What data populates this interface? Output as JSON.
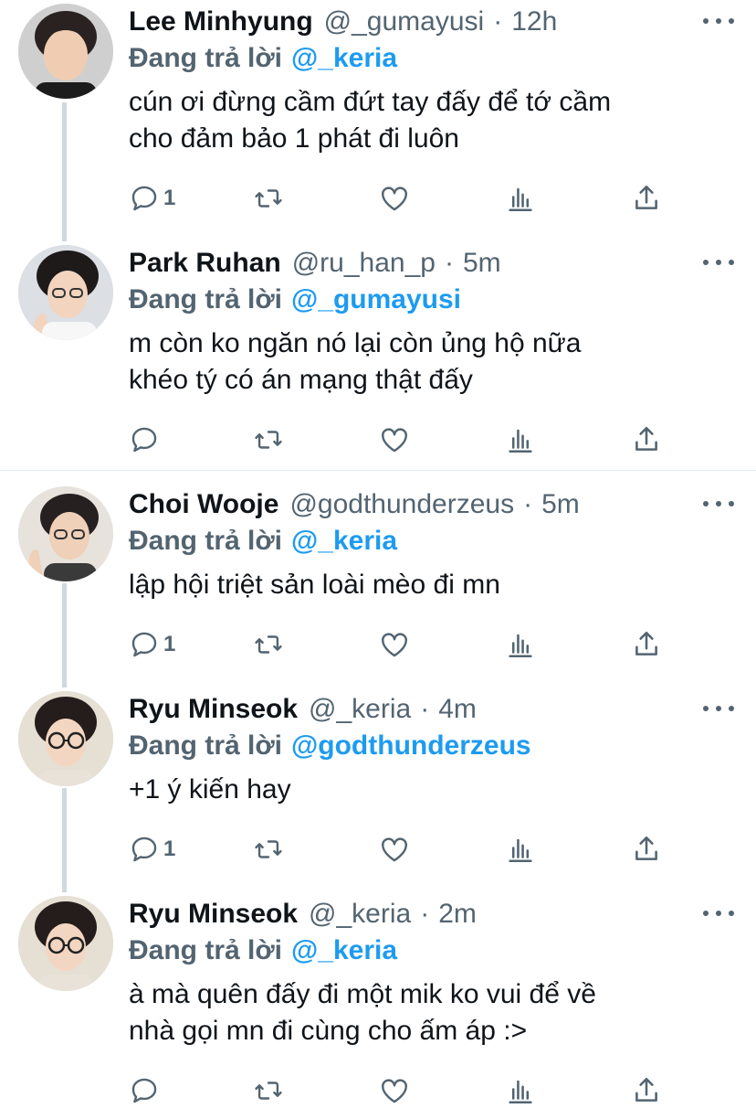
{
  "reply_prefix": "Đang trả lời",
  "tweets": [
    {
      "name": "Lee Minhyung",
      "handle": "@_gumayusi",
      "time": "12h",
      "reply_to": "@_keria",
      "text_lines": [
        "cún ơi đừng cầm đứt tay đấy để tớ cầm",
        "cho đảm bảo 1 phát đi luôn"
      ],
      "reply_count": "1",
      "avatar_icon": "avatar-photo"
    },
    {
      "name": "Park Ruhan",
      "handle": "@ru_han_p",
      "time": "5m",
      "reply_to": "@_gumayusi",
      "text_lines": [
        "m còn ko ngăn nó lại còn ủng hộ nữa",
        "khéo tý có án mạng thật đấy"
      ],
      "reply_count": "",
      "avatar_icon": "avatar-photo"
    },
    {
      "name": "Choi Wooje",
      "handle": "@godthunderzeus",
      "time": "5m",
      "reply_to": "@_keria",
      "text_lines": [
        "lập hội triệt sản loài mèo đi mn"
      ],
      "reply_count": "1",
      "avatar_icon": "avatar-photo"
    },
    {
      "name": "Ryu Minseok",
      "handle": "@_keria",
      "time": "4m",
      "reply_to": "@godthunderzeus",
      "text_lines": [
        "+1 ý kiến hay"
      ],
      "reply_count": "1",
      "avatar_icon": "avatar-photo"
    },
    {
      "name": "Ryu Minseok",
      "handle": "@_keria",
      "time": "2m",
      "reply_to": "@_keria",
      "text_lines": [
        "à mà quên đấy đi một mik ko vui để về",
        "nhà gọi mn đi cùng cho ấm áp :>"
      ],
      "reply_count": "",
      "avatar_icon": "avatar-photo"
    }
  ],
  "action_icons": [
    "reply-icon",
    "retweet-icon",
    "like-icon",
    "analytics-icon",
    "share-icon"
  ],
  "colors": {
    "accent": "#1d9bf0",
    "text": "#0f1419",
    "muted": "#536471",
    "thread_line": "#cfd9de"
  }
}
